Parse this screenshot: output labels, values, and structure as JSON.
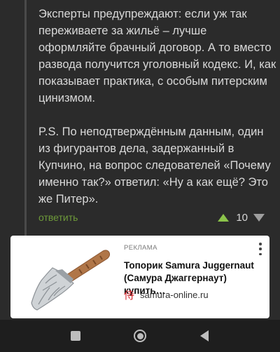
{
  "comment": {
    "paragraph1": "Эксперты предупреждают: если уж так переживаете за жильё – лучше оформляйте брачный договор. А то вместо развода получится уголовный кодекс. И, как показывает практика, с особым питерским цинизмом.",
    "paragraph2": "P.S. По неподтверждённым данным, один из фигурантов дела, задержанный в Купчино, на вопрос следователей «Почему именно так?» ответил: «Ну а как ещё? Это же Питер».",
    "reply_label": "ответить",
    "rating": "10"
  },
  "ad": {
    "label": "РЕКЛАМА",
    "title": "Топорик Samura Juggernaut (Самура Джаггернаут) купить…",
    "site": "samura-online.ru",
    "favicon_char": "侍",
    "image": "axe-image"
  },
  "colors": {
    "background": "#2b2b2b",
    "reply_link": "#6e9a3a",
    "upvote": "#8bc34a",
    "favicon": "#d2232a"
  },
  "navbar": {
    "icons": [
      "recent-apps-icon",
      "home-icon",
      "back-icon"
    ]
  }
}
